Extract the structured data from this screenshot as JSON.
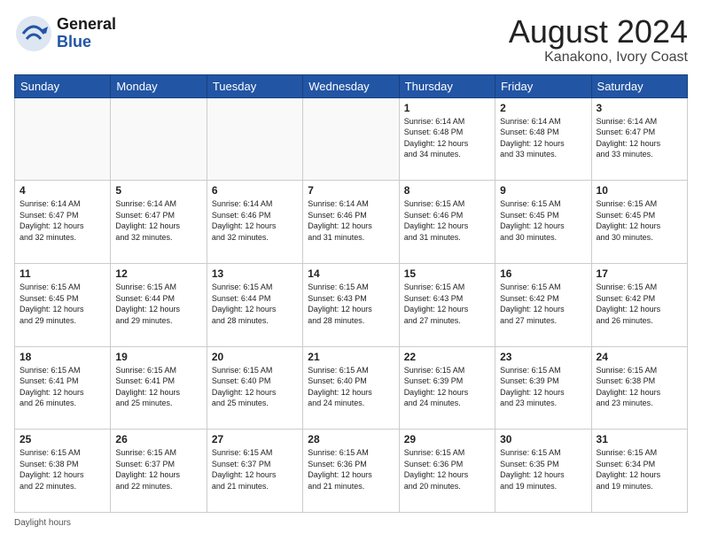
{
  "header": {
    "logo_general": "General",
    "logo_blue": "Blue",
    "title": "August 2024",
    "subtitle": "Kanakono, Ivory Coast"
  },
  "footer": {
    "label": "Daylight hours"
  },
  "days_of_week": [
    "Sunday",
    "Monday",
    "Tuesday",
    "Wednesday",
    "Thursday",
    "Friday",
    "Saturday"
  ],
  "weeks": [
    [
      {
        "day": "",
        "info": ""
      },
      {
        "day": "",
        "info": ""
      },
      {
        "day": "",
        "info": ""
      },
      {
        "day": "",
        "info": ""
      },
      {
        "day": "1",
        "info": "Sunrise: 6:14 AM\nSunset: 6:48 PM\nDaylight: 12 hours\nand 34 minutes."
      },
      {
        "day": "2",
        "info": "Sunrise: 6:14 AM\nSunset: 6:48 PM\nDaylight: 12 hours\nand 33 minutes."
      },
      {
        "day": "3",
        "info": "Sunrise: 6:14 AM\nSunset: 6:47 PM\nDaylight: 12 hours\nand 33 minutes."
      }
    ],
    [
      {
        "day": "4",
        "info": "Sunrise: 6:14 AM\nSunset: 6:47 PM\nDaylight: 12 hours\nand 32 minutes."
      },
      {
        "day": "5",
        "info": "Sunrise: 6:14 AM\nSunset: 6:47 PM\nDaylight: 12 hours\nand 32 minutes."
      },
      {
        "day": "6",
        "info": "Sunrise: 6:14 AM\nSunset: 6:46 PM\nDaylight: 12 hours\nand 32 minutes."
      },
      {
        "day": "7",
        "info": "Sunrise: 6:14 AM\nSunset: 6:46 PM\nDaylight: 12 hours\nand 31 minutes."
      },
      {
        "day": "8",
        "info": "Sunrise: 6:15 AM\nSunset: 6:46 PM\nDaylight: 12 hours\nand 31 minutes."
      },
      {
        "day": "9",
        "info": "Sunrise: 6:15 AM\nSunset: 6:45 PM\nDaylight: 12 hours\nand 30 minutes."
      },
      {
        "day": "10",
        "info": "Sunrise: 6:15 AM\nSunset: 6:45 PM\nDaylight: 12 hours\nand 30 minutes."
      }
    ],
    [
      {
        "day": "11",
        "info": "Sunrise: 6:15 AM\nSunset: 6:45 PM\nDaylight: 12 hours\nand 29 minutes."
      },
      {
        "day": "12",
        "info": "Sunrise: 6:15 AM\nSunset: 6:44 PM\nDaylight: 12 hours\nand 29 minutes."
      },
      {
        "day": "13",
        "info": "Sunrise: 6:15 AM\nSunset: 6:44 PM\nDaylight: 12 hours\nand 28 minutes."
      },
      {
        "day": "14",
        "info": "Sunrise: 6:15 AM\nSunset: 6:43 PM\nDaylight: 12 hours\nand 28 minutes."
      },
      {
        "day": "15",
        "info": "Sunrise: 6:15 AM\nSunset: 6:43 PM\nDaylight: 12 hours\nand 27 minutes."
      },
      {
        "day": "16",
        "info": "Sunrise: 6:15 AM\nSunset: 6:42 PM\nDaylight: 12 hours\nand 27 minutes."
      },
      {
        "day": "17",
        "info": "Sunrise: 6:15 AM\nSunset: 6:42 PM\nDaylight: 12 hours\nand 26 minutes."
      }
    ],
    [
      {
        "day": "18",
        "info": "Sunrise: 6:15 AM\nSunset: 6:41 PM\nDaylight: 12 hours\nand 26 minutes."
      },
      {
        "day": "19",
        "info": "Sunrise: 6:15 AM\nSunset: 6:41 PM\nDaylight: 12 hours\nand 25 minutes."
      },
      {
        "day": "20",
        "info": "Sunrise: 6:15 AM\nSunset: 6:40 PM\nDaylight: 12 hours\nand 25 minutes."
      },
      {
        "day": "21",
        "info": "Sunrise: 6:15 AM\nSunset: 6:40 PM\nDaylight: 12 hours\nand 24 minutes."
      },
      {
        "day": "22",
        "info": "Sunrise: 6:15 AM\nSunset: 6:39 PM\nDaylight: 12 hours\nand 24 minutes."
      },
      {
        "day": "23",
        "info": "Sunrise: 6:15 AM\nSunset: 6:39 PM\nDaylight: 12 hours\nand 23 minutes."
      },
      {
        "day": "24",
        "info": "Sunrise: 6:15 AM\nSunset: 6:38 PM\nDaylight: 12 hours\nand 23 minutes."
      }
    ],
    [
      {
        "day": "25",
        "info": "Sunrise: 6:15 AM\nSunset: 6:38 PM\nDaylight: 12 hours\nand 22 minutes."
      },
      {
        "day": "26",
        "info": "Sunrise: 6:15 AM\nSunset: 6:37 PM\nDaylight: 12 hours\nand 22 minutes."
      },
      {
        "day": "27",
        "info": "Sunrise: 6:15 AM\nSunset: 6:37 PM\nDaylight: 12 hours\nand 21 minutes."
      },
      {
        "day": "28",
        "info": "Sunrise: 6:15 AM\nSunset: 6:36 PM\nDaylight: 12 hours\nand 21 minutes."
      },
      {
        "day": "29",
        "info": "Sunrise: 6:15 AM\nSunset: 6:36 PM\nDaylight: 12 hours\nand 20 minutes."
      },
      {
        "day": "30",
        "info": "Sunrise: 6:15 AM\nSunset: 6:35 PM\nDaylight: 12 hours\nand 19 minutes."
      },
      {
        "day": "31",
        "info": "Sunrise: 6:15 AM\nSunset: 6:34 PM\nDaylight: 12 hours\nand 19 minutes."
      }
    ]
  ]
}
